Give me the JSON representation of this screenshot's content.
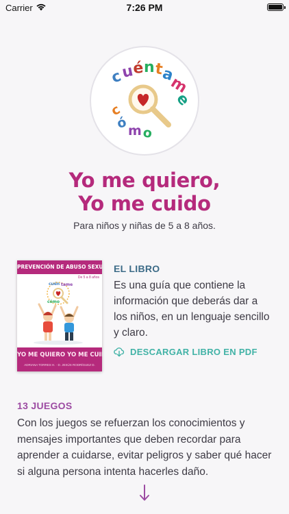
{
  "status_bar": {
    "carrier": "Carrier",
    "time": "7:26 PM"
  },
  "logo": {
    "word1": "cuéntame",
    "word2": "cómo",
    "icon": "magnifier-heart-icon"
  },
  "header": {
    "title_line1": "Yo me quiero,",
    "title_line2": "Yo me cuido",
    "subtitle": "Para niños y niñas de 5 a 8 años."
  },
  "book": {
    "cover": {
      "top_label": "PREVENCIÓN DE ABUSO SEXUAL",
      "age_label": "De 5 a 8 años",
      "title": "YO ME QUIERO YO ME CUIDO",
      "authors": "ADRIANA TORRES H. · D. JESÚS RODRÍGUEZ D."
    },
    "heading": "EL LIBRO",
    "description": "Es una guía que contiene la información que deberás dar a los niños, en un lenguaje sencillo y claro.",
    "download_label": "DESCARGAR LIBRO EN PDF"
  },
  "games": {
    "heading": "13 JUEGOS",
    "description": "Con los juegos se refuerzan los conocimientos y mensajes importantes que deben recordar para aprender a cuidarse, evitar peligros y saber qué hacer si alguna persona intenta hacerles daño."
  },
  "colors": {
    "brand_magenta": "#b52a7c",
    "book_heading": "#3c6b87",
    "download_teal": "#41b2a6",
    "games_purple": "#9c4ba2",
    "background": "#f7f6f8"
  }
}
